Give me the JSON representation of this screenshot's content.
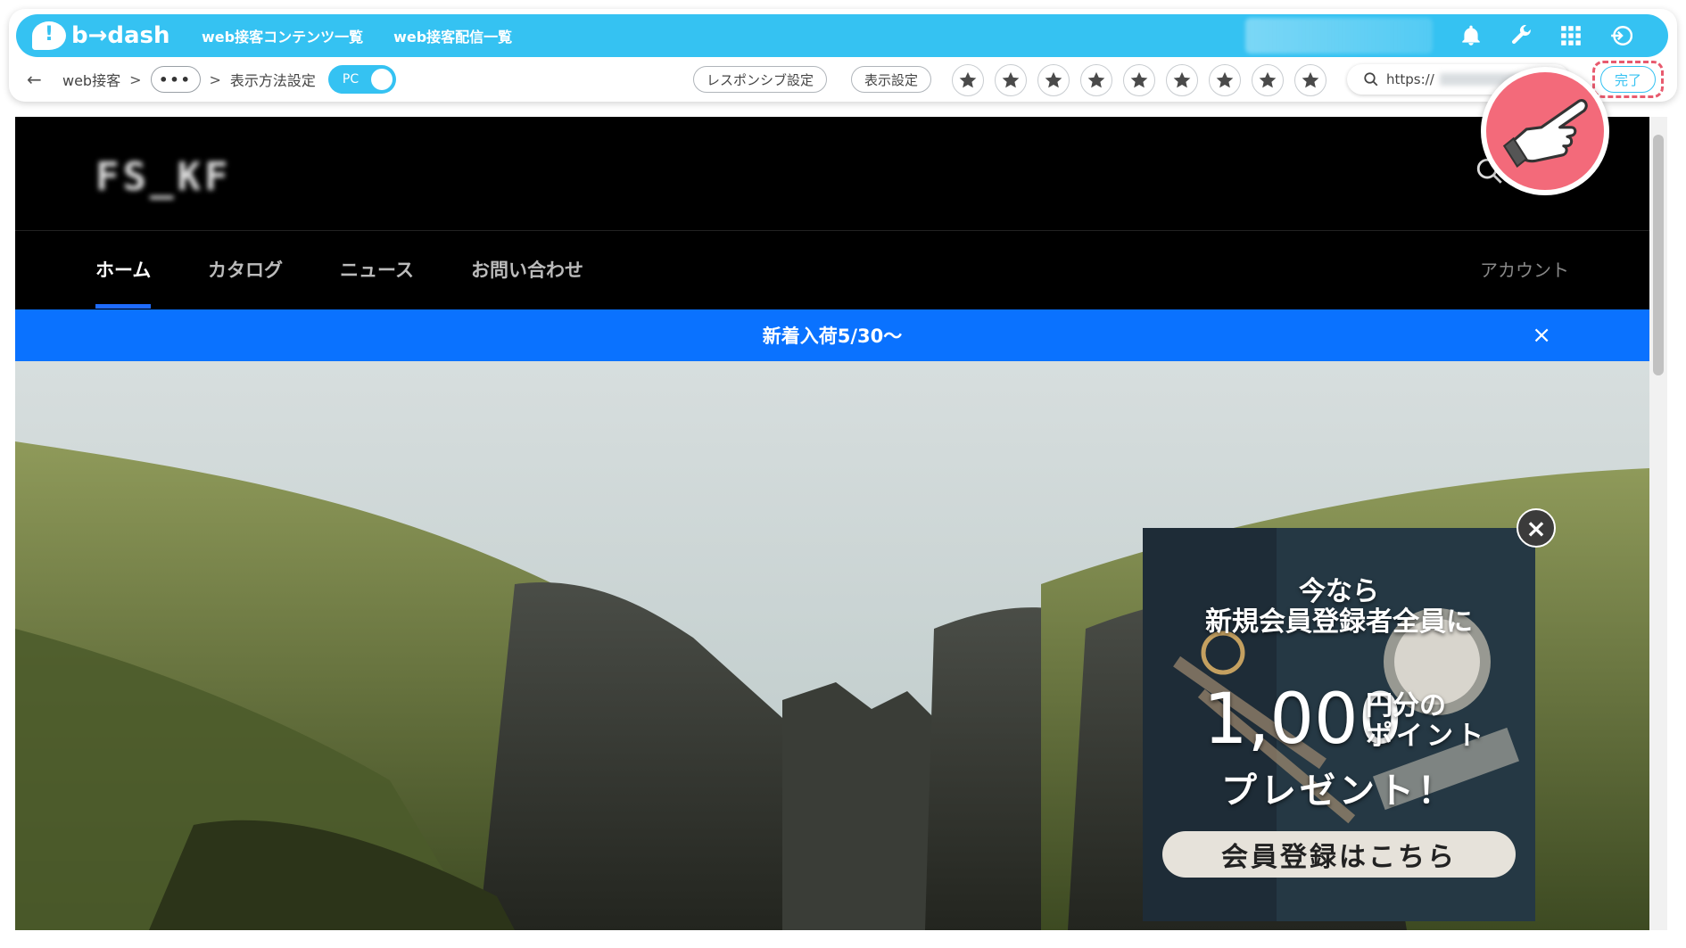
{
  "app": {
    "logo_text": "b→dash",
    "nav": [
      "web接客コンテンツ一覧",
      "web接客配信一覧"
    ]
  },
  "toolbar": {
    "breadcrumb_root": "web接客",
    "breadcrumb_sep": ">",
    "ellipsis": "•••",
    "breadcrumb_current": "表示方法設定",
    "device_toggle_label": "PC",
    "responsive_button": "レスポンシブ設定",
    "display_button": "表示設定",
    "star_count": 9,
    "url_prefix": "https://",
    "done_button": "完了"
  },
  "site": {
    "logo": "FS_KF",
    "nav": [
      "ホーム",
      "カタログ",
      "ニュース",
      "お問い合わせ"
    ],
    "account": "アカウント",
    "announcement": "新着入荷5/30〜",
    "announcement_close": "×"
  },
  "popup": {
    "line1": "今なら",
    "line2": "新規会員登録者全員に",
    "amount": "1,000",
    "unit_line1": "円分の",
    "unit_line2": "ポイント",
    "line4": "プレゼント！",
    "cta": "会員登録はこちら",
    "close": "×"
  },
  "colors": {
    "brand": "#35c2f2",
    "announce_bar": "#0a72ff",
    "highlight": "#e85a6e"
  }
}
